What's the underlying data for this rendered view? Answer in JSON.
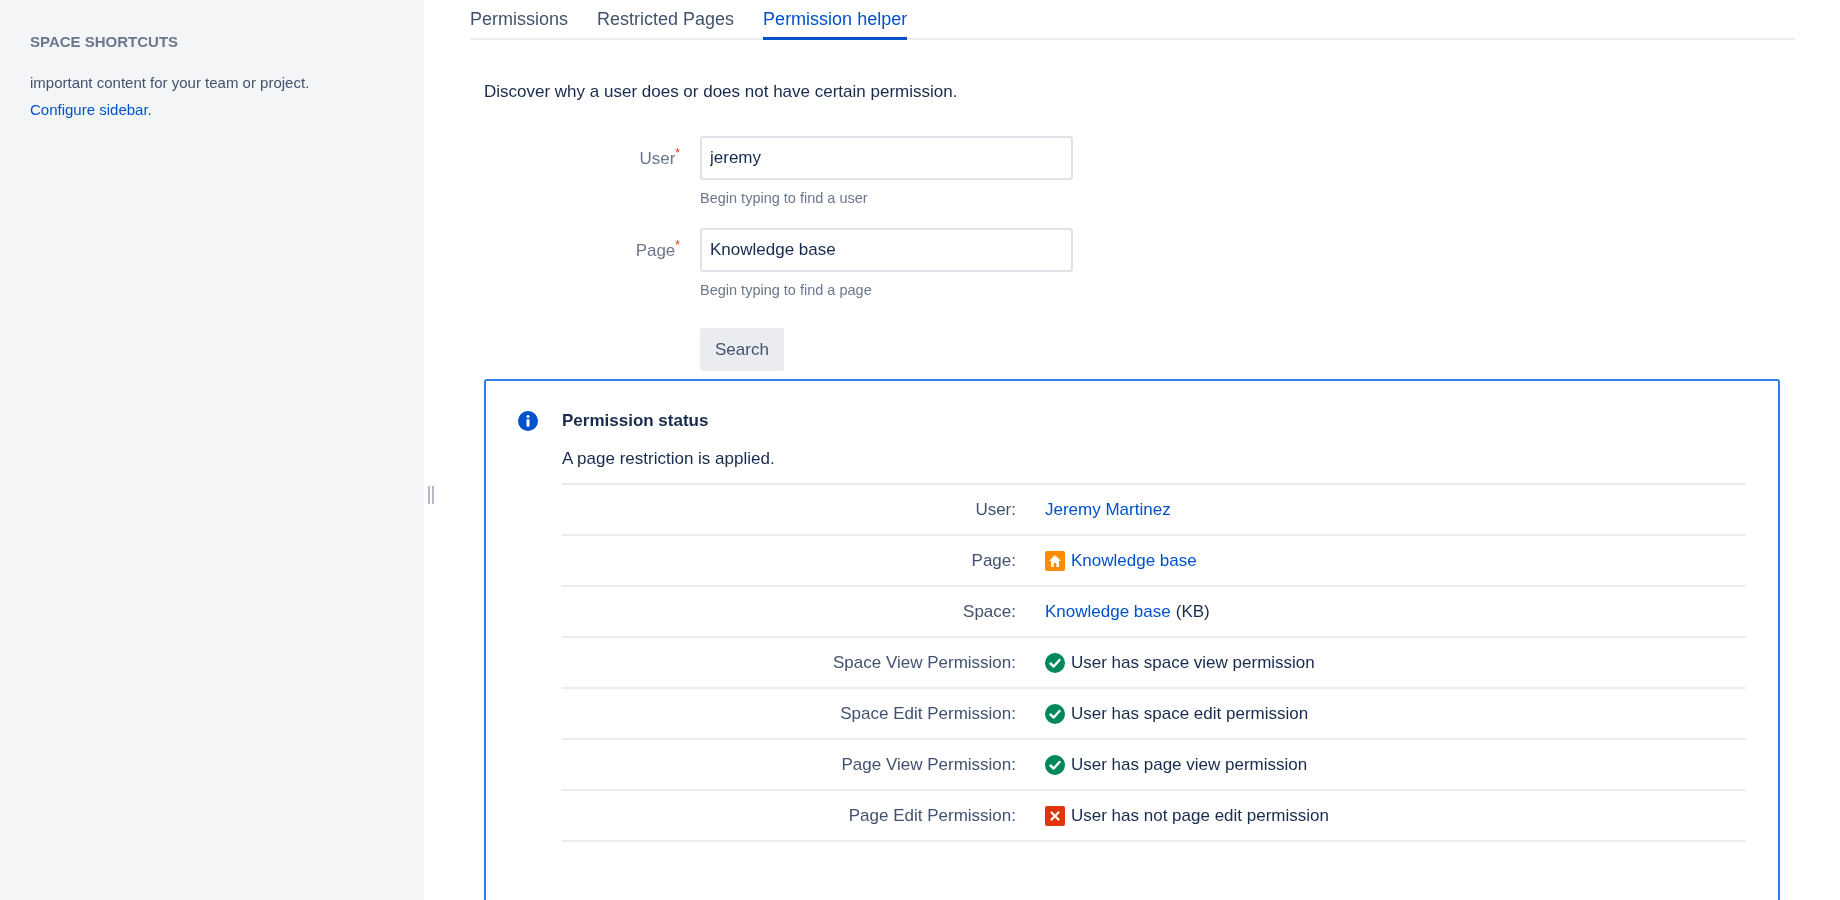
{
  "sidebar": {
    "heading": "SPACE SHORTCUTS",
    "text": "important content for your team or project.",
    "link": "Configure sidebar."
  },
  "tabs": [
    {
      "label": "Permissions",
      "selected": false
    },
    {
      "label": "Restricted Pages",
      "selected": false
    },
    {
      "label": "Permission helper",
      "selected": true
    }
  ],
  "description": "Discover why a user does or does not have certain permission.",
  "fields": [
    {
      "label": "User",
      "required_mark": "*",
      "value": "jeremy",
      "hint": "Begin typing to find a user"
    },
    {
      "label": "Page",
      "required_mark": "*",
      "value": "Knowledge base",
      "hint": "Begin typing to find a page"
    }
  ],
  "search_button": "Search",
  "status_panel": {
    "title": "Permission status",
    "message": "A page restriction is applied.",
    "rows": [
      {
        "label": "User:",
        "kind": "user",
        "link": "Jeremy Martinez"
      },
      {
        "label": "Page:",
        "kind": "page",
        "link": "Knowledge base"
      },
      {
        "label": "Space:",
        "kind": "space",
        "link": "Knowledge base",
        "suffix": "(KB)"
      },
      {
        "label": "Space View Permission:",
        "kind": "status",
        "granted": true,
        "text": "User has space view permission"
      },
      {
        "label": "Space Edit Permission:",
        "kind": "status",
        "granted": true,
        "text": "User has space edit permission"
      },
      {
        "label": "Page View Permission:",
        "kind": "status",
        "granted": true,
        "text": "User has page view permission"
      },
      {
        "label": "Page Edit Permission:",
        "kind": "status",
        "granted": false,
        "text": "User has not page edit permission"
      }
    ]
  }
}
